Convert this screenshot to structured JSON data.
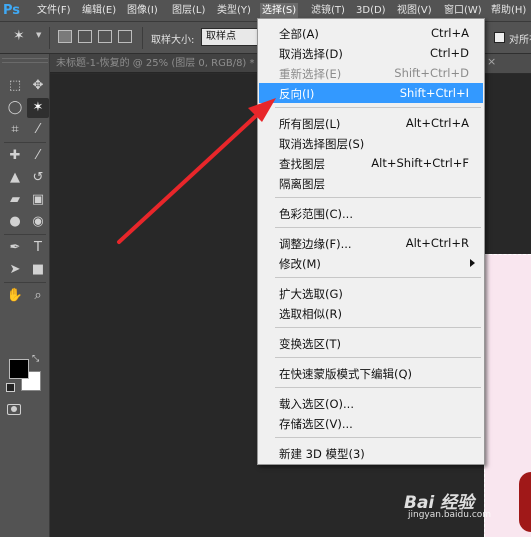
{
  "app": {
    "logo": "Ps"
  },
  "menubar": [
    {
      "label": "文件(F)"
    },
    {
      "label": "编辑(E)"
    },
    {
      "label": "图像(I)"
    },
    {
      "label": "图层(L)"
    },
    {
      "label": "类型(Y)"
    },
    {
      "label": "选择(S)"
    },
    {
      "label": "滤镜(T)"
    },
    {
      "label": "3D(D)"
    },
    {
      "label": "视图(V)"
    },
    {
      "label": "窗口(W)"
    },
    {
      "label": "帮助(H)"
    }
  ],
  "options_bar": {
    "sample_size_label": "取样大小:",
    "sample_size_value": "取样点",
    "checkbox_label": "对所有"
  },
  "document": {
    "tab_title": "未标题-1-恢复的 @ 25% (图层 0, RGB/8) *",
    "second_tab_label": "×"
  },
  "select_menu": {
    "items": [
      {
        "label": "全部(A)",
        "shortcut": "Ctrl+A"
      },
      {
        "label": "取消选择(D)",
        "shortcut": "Ctrl+D"
      },
      {
        "label": "重新选择(E)",
        "shortcut": "Shift+Ctrl+D"
      },
      {
        "label": "反向(I)",
        "shortcut": "Shift+Ctrl+I"
      },
      {
        "label": "所有图层(L)",
        "shortcut": "Alt+Ctrl+A"
      },
      {
        "label": "取消选择图层(S)",
        "shortcut": ""
      },
      {
        "label": "查找图层",
        "shortcut": "Alt+Shift+Ctrl+F"
      },
      {
        "label": "隔离图层",
        "shortcut": ""
      },
      {
        "label": "色彩范围(C)...",
        "shortcut": ""
      },
      {
        "label": "调整边缘(F)...",
        "shortcut": "Alt+Ctrl+R"
      },
      {
        "label": "修改(M)",
        "shortcut": ""
      },
      {
        "label": "扩大选取(G)",
        "shortcut": ""
      },
      {
        "label": "选取相似(R)",
        "shortcut": ""
      },
      {
        "label": "变换选区(T)",
        "shortcut": ""
      },
      {
        "label": "在快速蒙版模式下编辑(Q)",
        "shortcut": ""
      },
      {
        "label": "载入选区(O)...",
        "shortcut": ""
      },
      {
        "label": "存储选区(V)...",
        "shortcut": ""
      },
      {
        "label": "新建 3D 模型(3)",
        "shortcut": ""
      }
    ]
  },
  "watermark": {
    "logo": "Bai 经验",
    "url": "jingyan.baidu.com"
  },
  "colors": {
    "highlight": "#3399ff",
    "foreground_swatch": "#000000",
    "background_swatch": "#ffffff",
    "annotation_arrow": "#e8262a"
  },
  "icons": {
    "tools": [
      "move-tool-icon",
      "marquee-tool-icon",
      "lasso-tool-icon",
      "magic-wand-tool-icon",
      "crop-tool-icon",
      "eyedropper-tool-icon",
      "healing-brush-icon",
      "brush-tool-icon",
      "clone-stamp-icon",
      "history-brush-icon",
      "eraser-tool-icon",
      "gradient-tool-icon",
      "blur-tool-icon",
      "dodge-tool-icon",
      "pen-tool-icon",
      "type-tool-icon",
      "path-selection-icon",
      "rectangle-tool-icon",
      "hand-tool-icon",
      "zoom-tool-icon"
    ]
  }
}
